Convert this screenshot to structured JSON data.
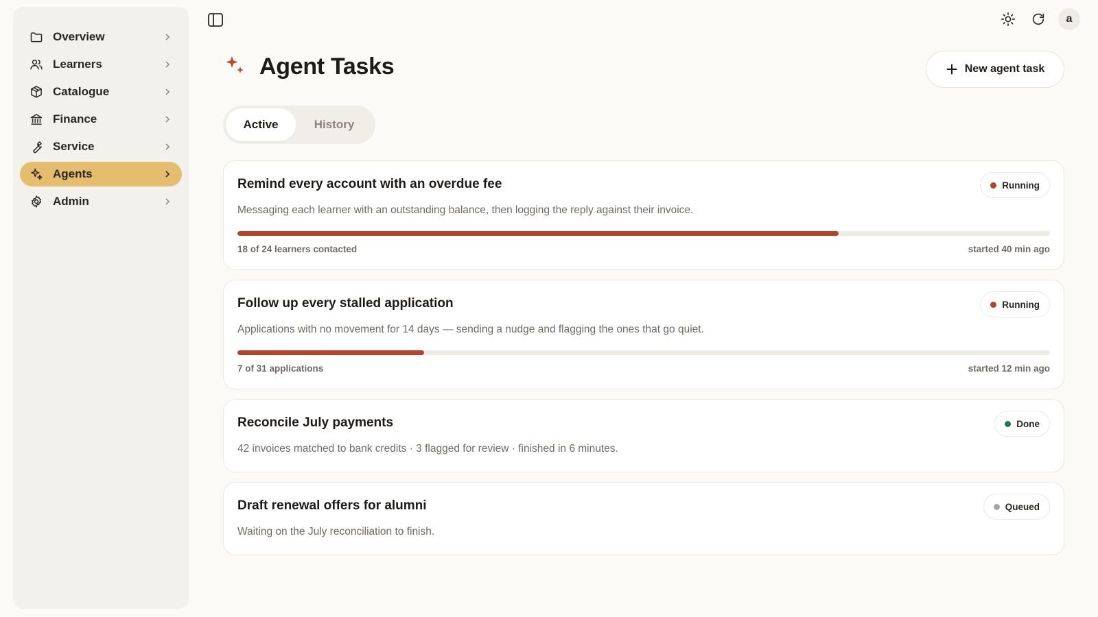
{
  "sidebar": {
    "items": [
      {
        "label": "Overview",
        "icon": "folder-icon",
        "active": false
      },
      {
        "label": "Learners",
        "icon": "users-icon",
        "active": false
      },
      {
        "label": "Catalogue",
        "icon": "package-icon",
        "active": false
      },
      {
        "label": "Finance",
        "icon": "bank-icon",
        "active": false
      },
      {
        "label": "Service",
        "icon": "wrench-icon",
        "active": false
      },
      {
        "label": "Agents",
        "icon": "sparkles-icon",
        "active": true
      },
      {
        "label": "Admin",
        "icon": "gear-icon",
        "active": false
      }
    ]
  },
  "topbar": {
    "avatar_letter": "a",
    "icons": [
      "sidebar-toggle-icon",
      "sun-icon",
      "refresh-icon"
    ]
  },
  "header": {
    "title": "Agent Tasks",
    "new_button_label": "New agent task"
  },
  "tabs": [
    {
      "label": "Active",
      "selected": true
    },
    {
      "label": "History",
      "selected": false
    }
  ],
  "colors": {
    "accent": "#e4be6e",
    "running": "#b5432b",
    "done": "#1f7a4d",
    "queued": "#a9a49c",
    "progress": "#b5432b"
  },
  "tasks": [
    {
      "title": "Remind every account with an overdue fee",
      "description": "Messaging each learner with an outstanding balance, then logging the reply against their invoice.",
      "status": "Running",
      "progress": 0.74,
      "progress_text": "18 of 24 learners contacted",
      "started": "started 40 min ago"
    },
    {
      "title": "Follow up every stalled application",
      "description": "Applications with no movement for 14 days — sending a nudge and flagging the ones that go quiet.",
      "status": "Running",
      "progress": 0.23,
      "progress_text": "7 of 31 applications",
      "started": "started 12 min ago"
    },
    {
      "title": "Reconcile July payments",
      "description": "42 invoices matched to bank credits · 3 flagged for review · finished in 6 minutes.",
      "status": "Done"
    },
    {
      "title": "Draft renewal offers for alumni",
      "description": "Waiting on the July reconciliation to finish.",
      "status": "Queued"
    }
  ]
}
